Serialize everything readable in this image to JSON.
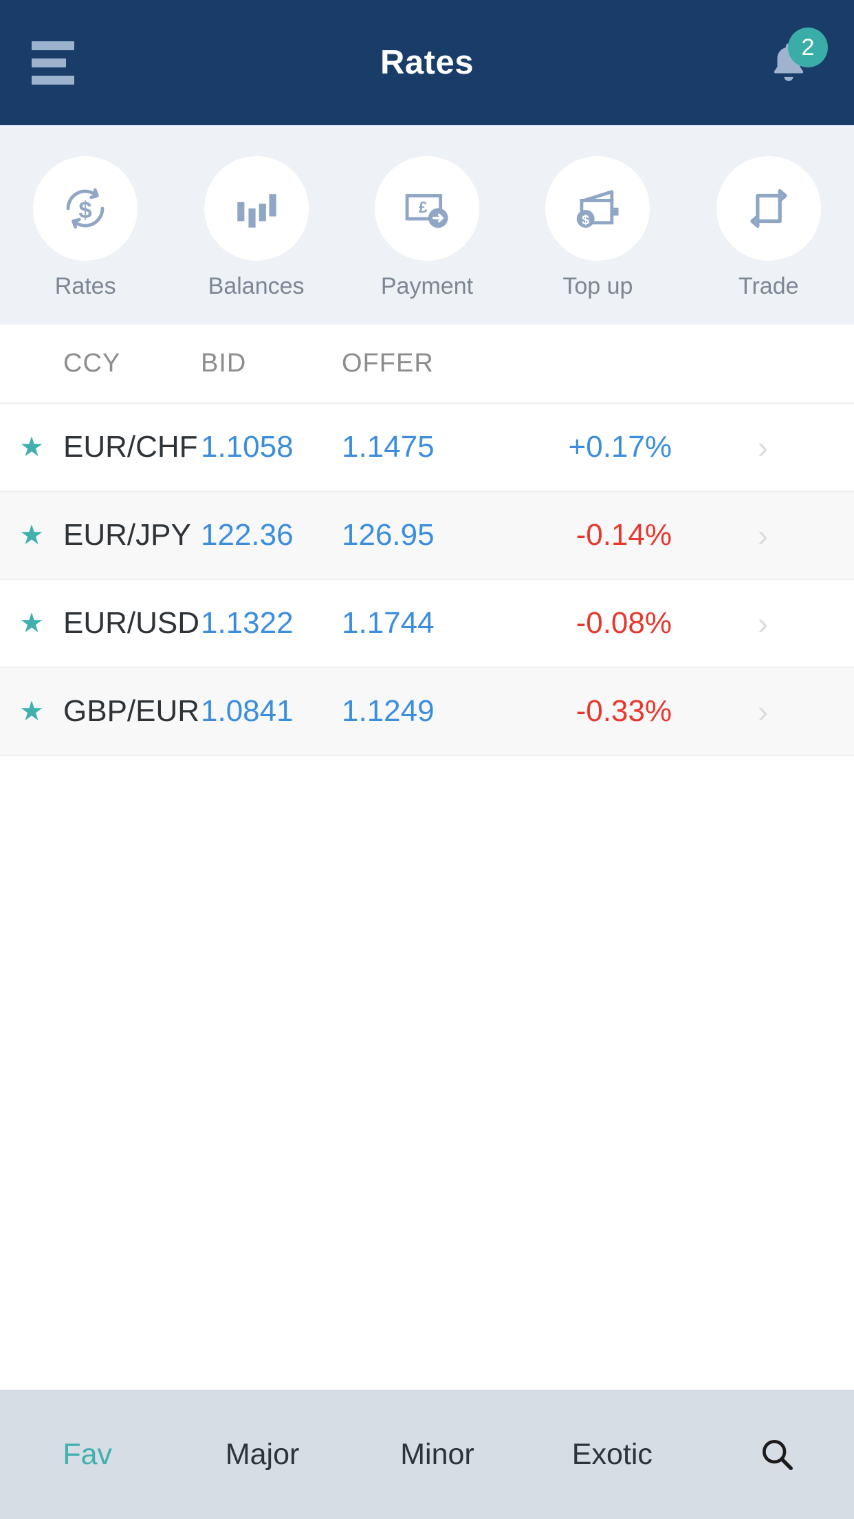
{
  "header": {
    "title": "Rates",
    "menu_icon": "hamburger-menu-icon",
    "bell_icon": "notification-bell-icon",
    "badge_count": "2",
    "bg_color": "#1a3c69",
    "badge_color": "#3aada8"
  },
  "quick_actions": [
    {
      "label": "Rates",
      "icon": "currency-refresh-icon"
    },
    {
      "label": "Balances",
      "icon": "bar-chart-icon"
    },
    {
      "label": "Payment",
      "icon": "banknote-pound-send-icon"
    },
    {
      "label": "Top up",
      "icon": "wallet-dollar-icon"
    },
    {
      "label": "Trade",
      "icon": "exchange-arrows-icon"
    }
  ],
  "table": {
    "columns": [
      "CCY",
      "BID",
      "OFFER"
    ],
    "rows": [
      {
        "favorite": "★",
        "ccy": "EUR/CHF",
        "bid": "1.1058",
        "offer": "1.1475",
        "change": "+0.17%",
        "direction": "up",
        "chevron": "›"
      },
      {
        "favorite": "★",
        "ccy": "EUR/JPY",
        "bid": "122.36",
        "offer": "126.95",
        "change": "-0.14%",
        "direction": "down",
        "chevron": "›"
      },
      {
        "favorite": "★",
        "ccy": "EUR/USD",
        "bid": "1.1322",
        "offer": "1.1744",
        "change": "-0.08%",
        "direction": "down",
        "chevron": "›"
      },
      {
        "favorite": "★",
        "ccy": "GBP/EUR",
        "bid": "1.0841",
        "offer": "1.1249",
        "change": "-0.33%",
        "direction": "down",
        "chevron": "›"
      }
    ]
  },
  "tabbar": {
    "tabs": [
      {
        "label": "Fav",
        "active": true
      },
      {
        "label": "Major",
        "active": false
      },
      {
        "label": "Minor",
        "active": false
      },
      {
        "label": "Exotic",
        "active": false
      }
    ],
    "search_icon": "search-icon",
    "active_color": "#3fb0ae"
  },
  "colors": {
    "positive": "#3b8ede",
    "negative": "#e8382d",
    "value": "#3b8ede",
    "accent_teal": "#3fb0ae",
    "navy": "#1a3c69"
  }
}
